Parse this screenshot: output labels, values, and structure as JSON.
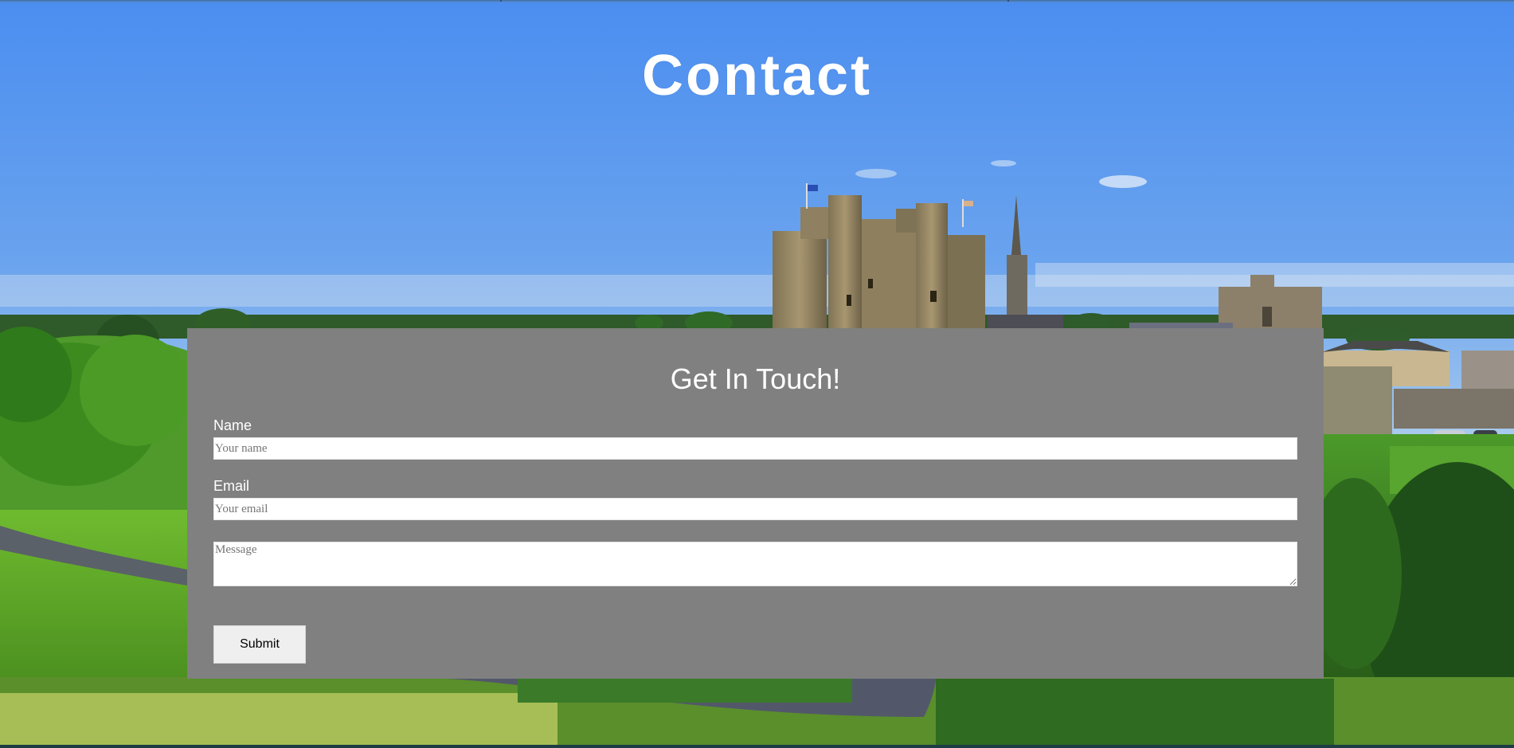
{
  "header": {
    "title": "Contact"
  },
  "contact_form": {
    "heading": "Get In Touch!",
    "name_label": "Name",
    "name_placeholder": "Your name",
    "name_value": "",
    "email_label": "Email",
    "email_placeholder": "Your email",
    "email_value": "",
    "message_placeholder": "Message",
    "message_value": "",
    "submit_label": "Submit"
  },
  "colors": {
    "panel_background": "#808080",
    "title_text": "#ffffff",
    "sky": "#4a8fe9",
    "button_background": "#efefef"
  }
}
